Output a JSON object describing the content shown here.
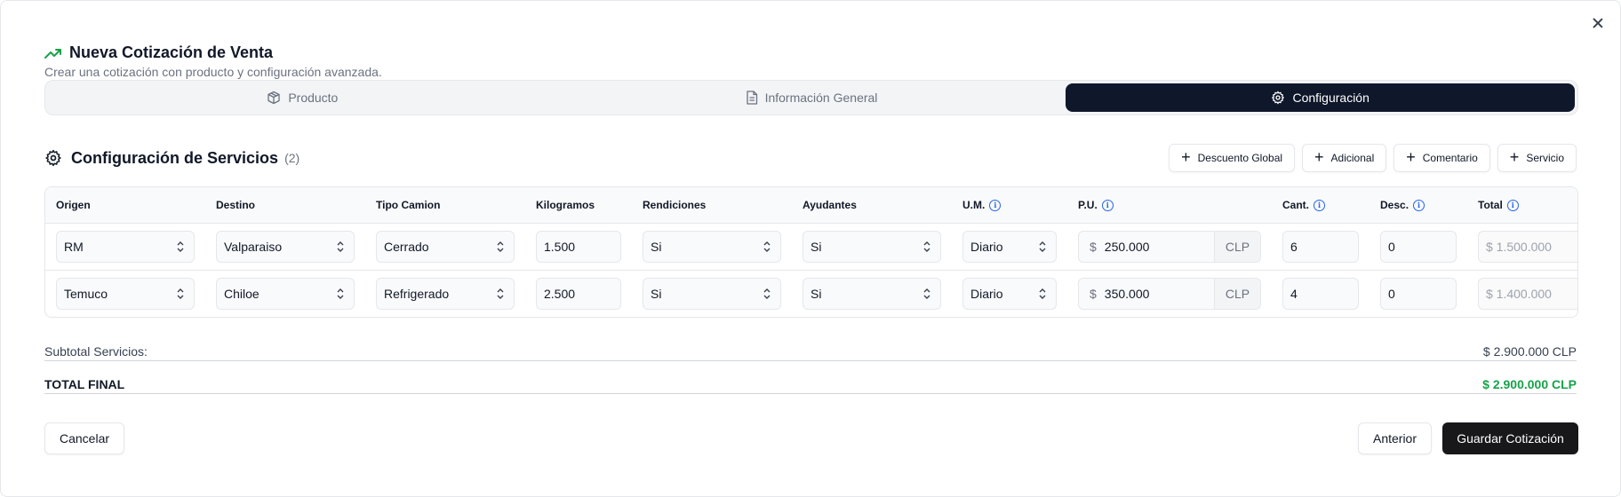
{
  "header": {
    "title": "Nueva Cotización de Venta",
    "subtitle": "Crear una cotización con producto y configuración avanzada."
  },
  "tabs": [
    {
      "label": "Producto",
      "icon": "box-icon",
      "active": false
    },
    {
      "label": "Información General",
      "icon": "file-text-icon",
      "active": false
    },
    {
      "label": "Configuración",
      "icon": "gear-icon",
      "active": true
    }
  ],
  "section": {
    "title": "Configuración de Servicios",
    "count": "(2)",
    "actions": [
      "Descuento Global",
      "Adicional",
      "Comentario",
      "Servicio"
    ]
  },
  "table": {
    "columns": [
      "Origen",
      "Destino",
      "Tipo Camion",
      "Kilogramos",
      "Rendiciones",
      "Ayudantes",
      "U.M.",
      "P.U.",
      "Cant.",
      "Desc.",
      "Total"
    ],
    "rows": [
      {
        "origen": "RM",
        "destino": "Valparaiso",
        "tipo": "Cerrado",
        "kg": "1.500",
        "rendiciones": "Si",
        "ayudantes": "Si",
        "um": "Diario",
        "currency": "$",
        "pu": "250.000",
        "pu_unit": "CLP",
        "cant": "6",
        "desc": "0",
        "total": "$ 1.500.000"
      },
      {
        "origen": "Temuco",
        "destino": "Chiloe",
        "tipo": "Refrigerado",
        "kg": "2.500",
        "rendiciones": "Si",
        "ayudantes": "Si",
        "um": "Diario",
        "currency": "$",
        "pu": "350.000",
        "pu_unit": "CLP",
        "cant": "4",
        "desc": "0",
        "total": "$ 1.400.000"
      }
    ]
  },
  "summary": {
    "subtotal_label": "Subtotal Servicios:",
    "subtotal_value": "$ 2.900.000 CLP",
    "total_label": "TOTAL FINAL",
    "total_value": "$ 2.900.000 CLP"
  },
  "footer": {
    "cancel": "Cancelar",
    "previous": "Anterior",
    "save": "Guardar Cotización"
  },
  "colors": {
    "active_tab": "#0f172a",
    "total_green": "#16a34a",
    "title_icon_green": "#16a34a",
    "info_blue": "#2563eb"
  }
}
